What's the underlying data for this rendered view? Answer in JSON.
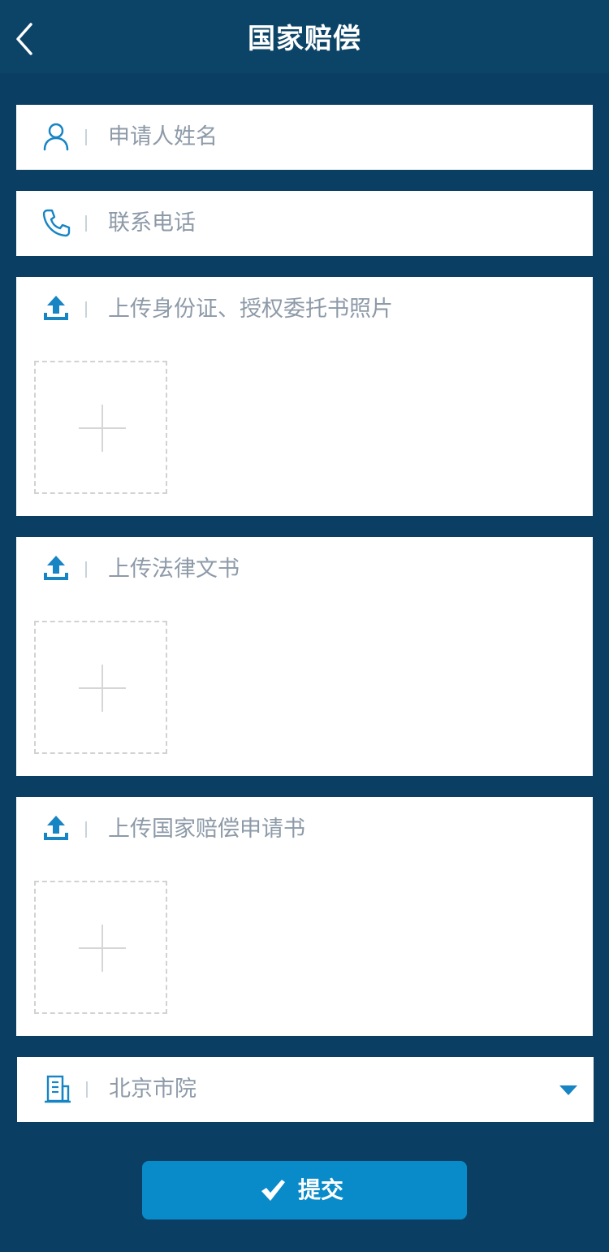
{
  "header": {
    "title": "国家赔偿"
  },
  "form": {
    "applicant_name": {
      "placeholder": "申请人姓名",
      "icon": "user-icon"
    },
    "phone": {
      "placeholder": "联系电话",
      "icon": "phone-icon"
    },
    "uploads": [
      {
        "label": "上传身份证、授权委托书照片",
        "icon": "upload-icon"
      },
      {
        "label": "上传法律文书",
        "icon": "upload-icon"
      },
      {
        "label": "上传国家赔偿申请书",
        "icon": "upload-icon"
      }
    ],
    "court_select": {
      "value": "北京市院",
      "icon": "building-icon"
    }
  },
  "submit": {
    "label": "提交",
    "icon": "check-icon"
  },
  "colors": {
    "background": "#0a3f63",
    "header": "#0c4467",
    "accent": "#1784c4",
    "button": "#0a8bc9",
    "placeholder_text": "#8d9aa8"
  }
}
